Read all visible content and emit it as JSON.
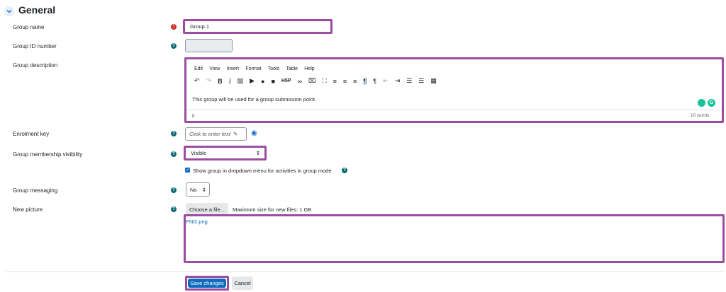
{
  "section": {
    "title": "General",
    "toggle_icon": "chevron-down-icon"
  },
  "fields": {
    "group_name": {
      "label": "Group name",
      "value": "Group 1"
    },
    "group_id": {
      "label": "Group ID number",
      "value": ""
    },
    "description": {
      "label": "Group description",
      "menu": [
        "Edit",
        "View",
        "Insert",
        "Format",
        "Tools",
        "Table",
        "Help"
      ],
      "content": "This group will be used for a group submission point.",
      "path": "p",
      "wordcount": "10 words"
    },
    "enrolment_key": {
      "label": "Enrolment key",
      "placeholder": "Click to enter text"
    },
    "visibility": {
      "label": "Group membership visibility",
      "value": "Visible"
    },
    "show_in_dropdown": {
      "label": "Show group in dropdown menu for activities in group mode",
      "checked": true
    },
    "messaging": {
      "label": "Group messaging",
      "value": "No"
    },
    "picture": {
      "label": "New picture",
      "button": "Choose a file...",
      "maxsize": "Maximum size for new files: 1 GB",
      "file": "PNG.png"
    }
  },
  "actions": {
    "save": "Save changes",
    "cancel": "Cancel"
  },
  "colors": {
    "accent": "#0f6cbf",
    "highlight": "#9b4da0",
    "help": "#0f6b74",
    "required": "#ca3120"
  }
}
